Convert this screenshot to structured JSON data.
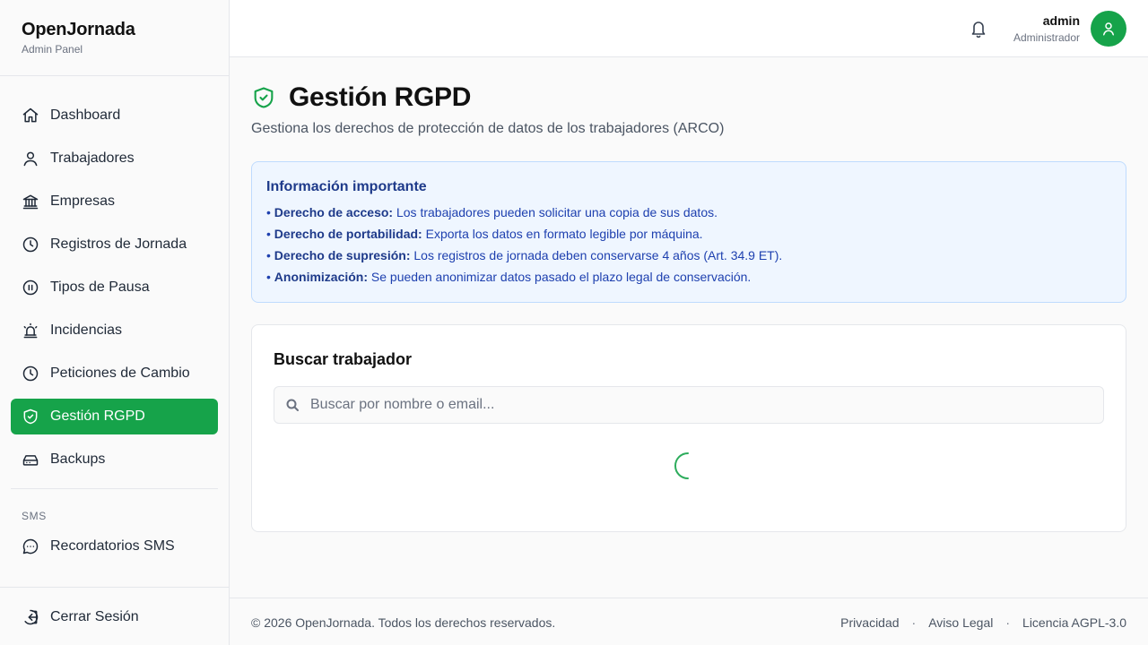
{
  "brand": {
    "title": "OpenJornada",
    "subtitle": "Admin Panel"
  },
  "sidebar": {
    "items": [
      {
        "label": "Dashboard",
        "icon": "home-icon"
      },
      {
        "label": "Trabajadores",
        "icon": "user-icon"
      },
      {
        "label": "Empresas",
        "icon": "building-icon"
      },
      {
        "label": "Registros de Jornada",
        "icon": "clock-icon"
      },
      {
        "label": "Tipos de Pausa",
        "icon": "pause-circle-icon"
      },
      {
        "label": "Incidencias",
        "icon": "siren-icon"
      },
      {
        "label": "Peticiones de Cambio",
        "icon": "clock-icon"
      },
      {
        "label": "Gestión RGPD",
        "icon": "shield-check-icon",
        "active": true
      },
      {
        "label": "Backups",
        "icon": "hard-drive-icon"
      }
    ],
    "section_label": "SMS",
    "sms_item": {
      "label": "Recordatorios SMS",
      "icon": "message-circle-icon"
    },
    "logout": {
      "label": "Cerrar Sesión",
      "icon": "logout-icon"
    }
  },
  "header": {
    "user_name": "admin",
    "user_role": "Administrador",
    "bell_icon": "bell-icon",
    "avatar_icon": "user-icon"
  },
  "page": {
    "title": "Gestión RGPD",
    "subtitle": "Gestiona los derechos de protección de datos de los trabajadores (ARCO)"
  },
  "info": {
    "title": "Información importante",
    "lines": [
      {
        "bold": "Derecho de acceso:",
        "text": " Los trabajadores pueden solicitar una copia de sus datos."
      },
      {
        "bold": "Derecho de portabilidad:",
        "text": " Exporta los datos en formato legible por máquina."
      },
      {
        "bold": "Derecho de supresión:",
        "text": " Los registros de jornada deben conservarse 4 años (Art. 34.9 ET)."
      },
      {
        "bold": "Anonimización:",
        "text": " Se pueden anonimizar datos pasado el plazo legal de conservación."
      }
    ]
  },
  "search_card": {
    "title": "Buscar trabajador",
    "placeholder": "Buscar por nombre o email...",
    "value": ""
  },
  "footer": {
    "copyright": "© 2026 OpenJornada. Todos los derechos reservados.",
    "links": [
      "Privacidad",
      "Aviso Legal",
      "Licencia AGPL-3.0"
    ]
  },
  "colors": {
    "accent": "#16a34a",
    "info_bg": "#eff6ff",
    "info_border": "#bfdbfe",
    "info_text": "#1e40af"
  }
}
